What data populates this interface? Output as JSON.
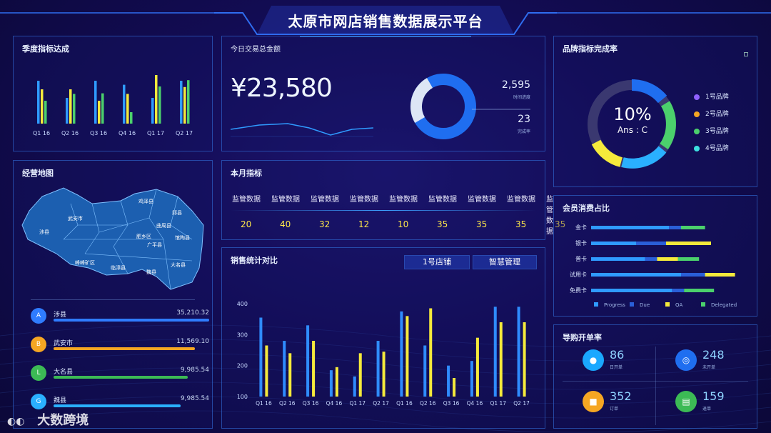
{
  "header": {
    "title": "太原市网店销售数据展示平台"
  },
  "quarterly": {
    "title": "季度指标达成",
    "categories": [
      "Q1 16",
      "Q2 16",
      "Q3 16",
      "Q4 16",
      "Q1 17",
      "Q2 17"
    ],
    "series": [
      {
        "color": "#2f9bff",
        "values": [
          75,
          45,
          75,
          68,
          45,
          75
        ]
      },
      {
        "color": "#f5ea3b",
        "values": [
          60,
          60,
          40,
          52,
          85,
          64
        ]
      },
      {
        "color": "#4bd06c",
        "values": [
          40,
          52,
          53,
          20,
          65,
          76
        ]
      }
    ]
  },
  "today": {
    "title": "今日交易总金额",
    "amount": "¥23,580",
    "stat1_value": "2,595",
    "stat1_label": "时间进度",
    "stat2_value": "23",
    "stat2_label": "完成率"
  },
  "brand": {
    "title": "品牌指标完成率",
    "center_value": "10%",
    "center_label": "Ans : C",
    "legend": [
      {
        "label": "1号品牌",
        "color": "#9060ff"
      },
      {
        "label": "2号品牌",
        "color": "#f5a623"
      },
      {
        "label": "3号品牌",
        "color": "#4bd06c"
      },
      {
        "label": "4号品牌",
        "color": "#3de0e0"
      }
    ]
  },
  "map": {
    "title": "经营地图",
    "labels": [
      "鸡泽县",
      "武安市",
      "邱县",
      "涉县",
      "曲周县",
      "肥乡区",
      "馆陶县",
      "广平县",
      "峰峰矿区",
      "临漳县",
      "魏县",
      "大名县"
    ]
  },
  "ranking": [
    {
      "badge": "A",
      "name": "涉县",
      "value": "35,210.32",
      "color": "#2f7cff",
      "fill": 1.0
    },
    {
      "badge": "B",
      "name": "武安市",
      "value": "11,569.10",
      "color": "#f5a623",
      "fill": 0.9
    },
    {
      "badge": "L",
      "name": "大名县",
      "value": "9,985.54",
      "color": "#3cba55",
      "fill": 0.85
    },
    {
      "badge": "G",
      "name": "魏县",
      "value": "9,985.54",
      "color": "#2ab0ff",
      "fill": 0.8
    }
  ],
  "monthly": {
    "title": "本月指标",
    "items": [
      {
        "label": "监管数据",
        "value": "20"
      },
      {
        "label": "监管数据",
        "value": "40"
      },
      {
        "label": "监管数据",
        "value": "32"
      },
      {
        "label": "监管数据",
        "value": "12"
      },
      {
        "label": "监管数据",
        "value": "10"
      },
      {
        "label": "监管数据",
        "value": "35"
      },
      {
        "label": "监管数据",
        "value": "35"
      },
      {
        "label": "监管数据",
        "value": "35"
      },
      {
        "label": "监管数据",
        "value": "35"
      }
    ]
  },
  "sales": {
    "title": "销售统计对比",
    "tab1": "1号店铺",
    "tab2": "智慧管理",
    "chart_data": {
      "type": "bar",
      "categories": [
        "Q1 16",
        "Q2 16",
        "Q3 16",
        "Q4 16",
        "Q1 17",
        "Q2 17",
        "Q1 16",
        "Q2 16",
        "Q3 16",
        "Q4 16",
        "Q1 17",
        "Q2 17"
      ],
      "series": [
        {
          "color": "#2f8cff",
          "values": [
            355,
            280,
            330,
            185,
            165,
            280,
            375,
            265,
            200,
            215,
            390,
            390
          ]
        },
        {
          "color": "#f5ea3b",
          "values": [
            265,
            240,
            280,
            195,
            240,
            245,
            360,
            385,
            160,
            290,
            340,
            340
          ]
        }
      ],
      "yticks": [
        "100",
        "200",
        "300",
        "400"
      ],
      "ylim": [
        100,
        400
      ]
    }
  },
  "member": {
    "title": "会员消费占比",
    "rows": [
      {
        "label": "金卡",
        "segments": [
          0.52,
          0.08,
          0.0,
          0.16
        ]
      },
      {
        "label": "银卡",
        "segments": [
          0.3,
          0.2,
          0.3,
          0.0
        ]
      },
      {
        "label": "普卡",
        "segments": [
          0.36,
          0.08,
          0.14,
          0.14
        ]
      },
      {
        "label": "试用卡",
        "segments": [
          0.6,
          0.16,
          0.2,
          0.0
        ]
      },
      {
        "label": "免费卡",
        "segments": [
          0.54,
          0.08,
          0.0,
          0.2
        ]
      }
    ],
    "colors": [
      "#2f9bff",
      "#2a5fd8",
      "#f5ea3b",
      "#4bd06c"
    ],
    "legend": [
      "Progress",
      "Due",
      "QA",
      "Delegated"
    ]
  },
  "guide": {
    "title": "导购开单率",
    "items": [
      {
        "value": "86",
        "label": "日开单",
        "color": "#1aa8ff",
        "icon": "user-icon"
      },
      {
        "value": "248",
        "label": "未开单",
        "color": "#1f6ef0",
        "icon": "target-icon"
      },
      {
        "value": "352",
        "label": "订单",
        "color": "#f5a623",
        "icon": "cart-icon"
      },
      {
        "value": "159",
        "label": "退单",
        "color": "#3cba55",
        "icon": "doc-icon"
      }
    ]
  },
  "watermark": {
    "text": "大数跨境"
  }
}
